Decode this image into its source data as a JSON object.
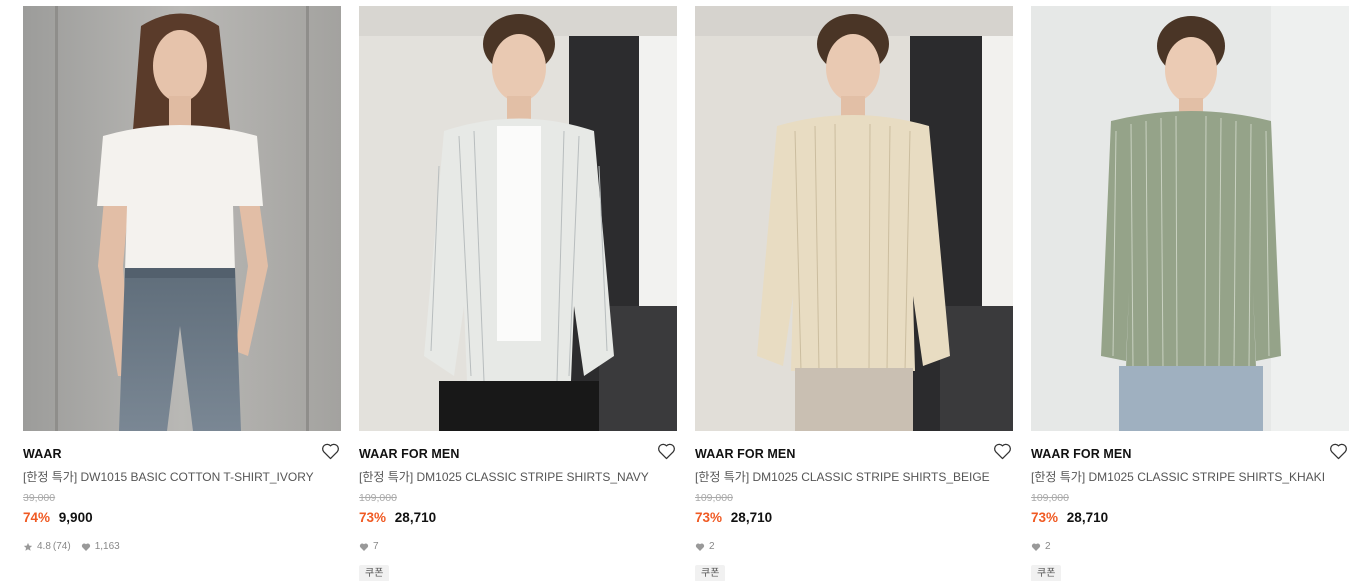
{
  "products": [
    {
      "brand": "WAAR",
      "name": "[한정 특가] DW1015 BASIC COTTON T-SHIRT_IVORY",
      "original_price": "39,000",
      "discount": "74%",
      "sale_price": "9,900",
      "rating": "4.8",
      "review_count": "(74)",
      "likes": "1,163"
    },
    {
      "brand": "WAAR FOR MEN",
      "name": "[한정 특가] DM1025 CLASSIC STRIPE SHIRTS_NAVY",
      "original_price": "109,000",
      "discount": "73%",
      "sale_price": "28,710",
      "likes": "7",
      "badge": "쿠폰"
    },
    {
      "brand": "WAAR FOR MEN",
      "name": "[한정 특가] DM1025 CLASSIC STRIPE SHIRTS_BEIGE",
      "original_price": "109,000",
      "discount": "73%",
      "sale_price": "28,710",
      "likes": "2",
      "badge": "쿠폰"
    },
    {
      "brand": "WAAR FOR MEN",
      "name": "[한정 특가] DM1025 CLASSIC STRIPE SHIRTS_KHAKI",
      "original_price": "109,000",
      "discount": "73%",
      "sale_price": "28,710",
      "likes": "2",
      "badge": "쿠폰"
    }
  ],
  "icons": {
    "wishlist": "heart-outline-icon",
    "rating": "star-icon",
    "likes": "heart-filled-icon"
  },
  "colors": {
    "discount": "#f05a23",
    "strike_price": "#aaaaaa",
    "badge_bg": "#f1f1f1"
  }
}
